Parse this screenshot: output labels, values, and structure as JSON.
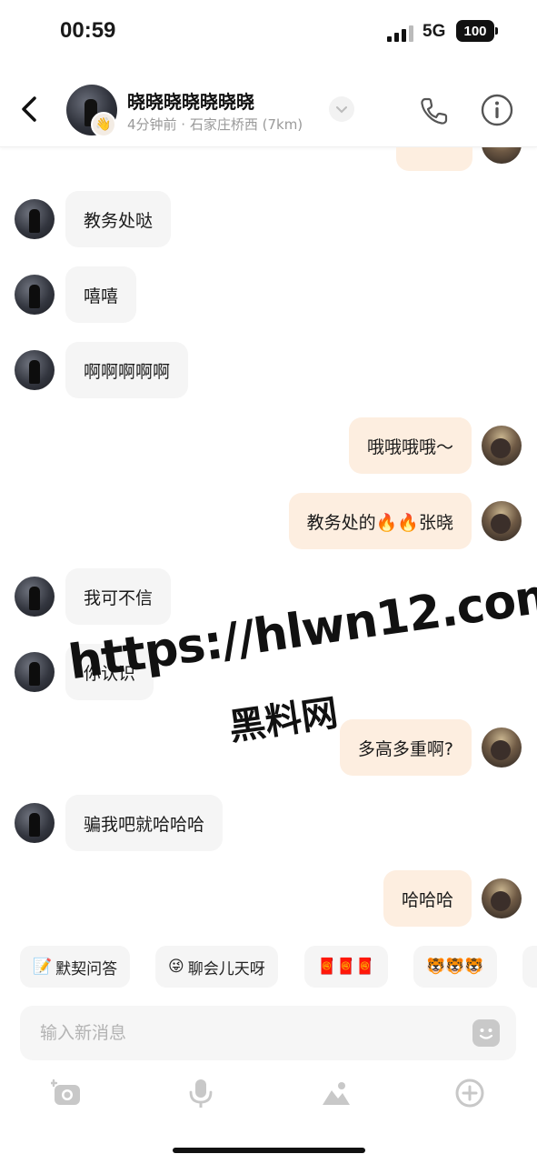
{
  "status_bar": {
    "time": "00:59",
    "network": "5G",
    "battery": "100"
  },
  "header": {
    "name": "晓晓晓晓晓晓晓",
    "subtitle": "4分钟前 · 石家庄桥西 (7km)",
    "avatar_badge_icon": "hand-wave-icon"
  },
  "messages": [
    {
      "from": "other",
      "text": "教务处哒"
    },
    {
      "from": "other",
      "text": "嘻嘻"
    },
    {
      "from": "other",
      "text": "啊啊啊啊啊"
    },
    {
      "from": "me",
      "text": "哦哦哦哦～"
    },
    {
      "from": "me",
      "text": "教务处的🔥🔥张晓"
    },
    {
      "from": "other",
      "text": "我可不信"
    },
    {
      "from": "other",
      "text": "你认识"
    },
    {
      "from": "me",
      "text": "多高多重啊?"
    },
    {
      "from": "other",
      "text": "骗我吧就哈哈哈"
    },
    {
      "from": "me",
      "text": "哈哈哈"
    }
  ],
  "watermark": {
    "line1": "https://hlwn12.com",
    "line2": "黑料网"
  },
  "chips": [
    {
      "icon": "📝",
      "label": "默契问答"
    },
    {
      "icon": "😜",
      "label": "聊会儿天呀"
    },
    {
      "icon": "",
      "label": "🧧🧧🧧"
    },
    {
      "icon": "",
      "label": "🐯🐯🐯"
    }
  ],
  "input": {
    "placeholder": "输入新消息"
  },
  "toolbar": [
    "camera-icon",
    "microphone-icon",
    "image-icon",
    "plus-icon"
  ],
  "colors": {
    "my_bubble": "#fdeee0",
    "other_bubble": "#f5f5f5",
    "accent": "#111111"
  }
}
